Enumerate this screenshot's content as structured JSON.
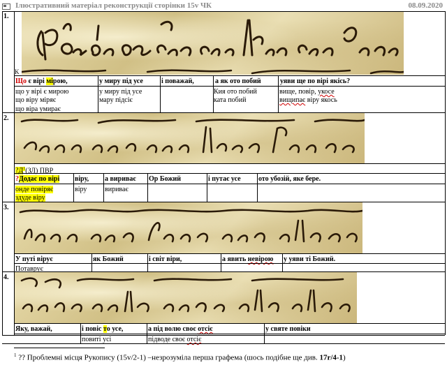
{
  "header": {
    "title": "Ілюстративний матеріал реконструкції сторінки 15v  ЧК",
    "date": "08.09.2020"
  },
  "rows": [
    {
      "number": "1.",
      "image_letter": "K",
      "head": {
        "c1_pre": "Що",
        "c1_mid": " є вірі ",
        "c1_hl": "мі",
        "c1_post": "рою,",
        "c2": "у миру під усе",
        "c3": "і поважай,",
        "c4": "а як ото побий",
        "c5": "уяви ще по вірі якісь?"
      },
      "notes": {
        "c1": [
          "що у вірі є мирою",
          "що віру міряє",
          "що віра умирає"
        ],
        "c2": [
          "у миру під усе",
          "мару підсіє"
        ],
        "c4": [
          "Кия ото побий",
          "ката побий"
        ],
        "c5_l1_a": "вище, повір, ",
        "c5_l1_b": "укосе",
        "c5_l2_a": "",
        "c5_l2_b": "вищипає",
        "c5_l2_c": " віру якось"
      }
    },
    {
      "number": "2.",
      "pre_sup": "?Д",
      "pre_sup_mark": "1",
      "pre_tail": "(ЗЛ) ПВР",
      "head": {
        "c1_pre": "?",
        "c1_post": "Додає по вірі",
        "c2": "віру,",
        "c3": "а вириває",
        "c4": "Ор Божий",
        "c5": "і путає усе",
        "c6": "ото убозій, яке бере."
      },
      "notes": {
        "c1": [
          "онде повіряє",
          "здуде віру"
        ],
        "c2": [
          "віру"
        ],
        "c3": [
          "вириває"
        ]
      }
    },
    {
      "number": "3.",
      "head": {
        "c1": "У путі вірує",
        "c2": "як Божий",
        "c3": "і світ віри,",
        "c4_pre": "а явить ",
        "c4_wavy": "невірою",
        "c5": "у уяви ті Божий."
      },
      "notes": {
        "c1": [
          "Потаврує"
        ]
      }
    },
    {
      "number": "4.",
      "head": {
        "c1": "Яку, важай,",
        "c2_pre": "і повіс ",
        "c2_hl": "т",
        "c2_post": "о усе,",
        "c3_pre": "а під волю своє ",
        "c3_wavy": "отсіє",
        "c4": "у святе повіки"
      },
      "notes": {
        "c2": "повиті усі",
        "c3_pre": "підводе своє ",
        "c3_wavy": "отсіє"
      }
    }
  ],
  "footnote": {
    "mark": "1",
    "text": " ?? Проблемні місця Рукопису (15v/2-1) –незрозуміла перша графема (шось подібне ще див. ",
    "ref": "17r/4-1",
    "close": ")"
  },
  "colors": {
    "image_bg": "#d8c890",
    "ink": "#2a1a08",
    "highlight": "#ffff00",
    "red": "#d00000",
    "header_gray": "#8a8a8a"
  }
}
